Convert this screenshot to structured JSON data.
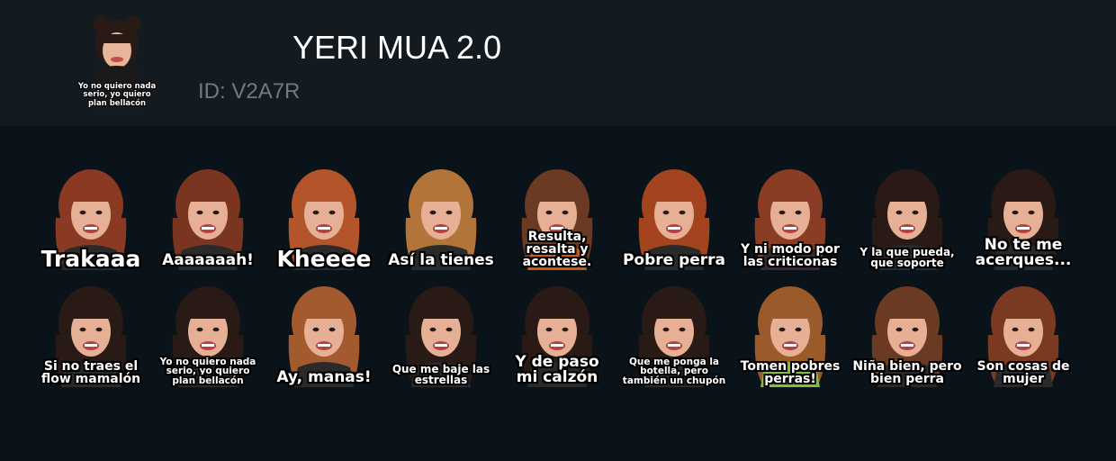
{
  "header": {
    "title": "YERI MUA 2.0",
    "id_text": "ID: V2A7R",
    "thumbnail_caption": "Yo no quiero nada serio, yo quiero plan bellacón"
  },
  "stickers": [
    {
      "caption": "Trakaaa",
      "size": "xl",
      "hair": "#8a3a22",
      "bg": "#2a2a2a"
    },
    {
      "caption": "Aaaaaaah!",
      "size": "l",
      "hair": "#7a3520",
      "bg": "#2a2a2a"
    },
    {
      "caption": "Kheeee",
      "size": "xl",
      "hair": "#b4542a",
      "bg": "#2a2a2a"
    },
    {
      "caption": "Así la tienes",
      "size": "l",
      "hair": "#b27438",
      "bg": "#2a2a2a"
    },
    {
      "caption": "Resulta, resalta y acontese.",
      "size": "m",
      "hair": "#6a3a22",
      "bg": "#c85a1a"
    },
    {
      "caption": "Pobre perra",
      "size": "l",
      "hair": "#a3441e",
      "bg": "#2a2a2a"
    },
    {
      "caption": "Y ni modo por las criticonas",
      "size": "m",
      "hair": "#8a3c24",
      "bg": "#3a2a30"
    },
    {
      "caption": "Y la que pueda, que soporte",
      "size": "s",
      "hair": "#2a1a16",
      "bg": "#2a2a2a"
    },
    {
      "caption": "No te me acerques...",
      "size": "l",
      "hair": "#2a1a16",
      "bg": "#2a2a2a"
    },
    {
      "caption": "Si no traes el flow mamalón",
      "size": "m",
      "hair": "#2a1a16",
      "bg": "#2a2a2a"
    },
    {
      "caption": "Yo no quiero nada serio, yo quiero plan bellacón",
      "size": "xs",
      "hair": "#2a1a16",
      "bg": "#2a2a2a"
    },
    {
      "caption": "Ay, manas!",
      "size": "l",
      "hair": "#a35a2e",
      "bg": "#2a2a2a"
    },
    {
      "caption": "Que me baje las estrellas",
      "size": "s",
      "hair": "#2a1a16",
      "bg": "#2a2a2a"
    },
    {
      "caption": "Y de paso mi calzón",
      "size": "l",
      "hair": "#2a1a16",
      "bg": "#2a2a2a"
    },
    {
      "caption": "Que me ponga la botella, pero también un chupón",
      "size": "xs",
      "hair": "#2a1a16",
      "bg": "#2a2a2a"
    },
    {
      "caption": "Tomen pobres perras!",
      "size": "m",
      "hair": "#9a5a2a",
      "bg": "#7fbf3a"
    },
    {
      "caption": "Niña bien, pero bien perra",
      "size": "m",
      "hair": "#6a3a22",
      "bg": "#2a2a2a"
    },
    {
      "caption": "Son cosas de mujer",
      "size": "m",
      "hair": "#7a3a22",
      "bg": "#2a2a2a"
    }
  ],
  "colors": {
    "header_bg": "#131b21",
    "page_bg": "#0b131a",
    "title": "#ffffff",
    "id_text": "#6f7a82"
  }
}
